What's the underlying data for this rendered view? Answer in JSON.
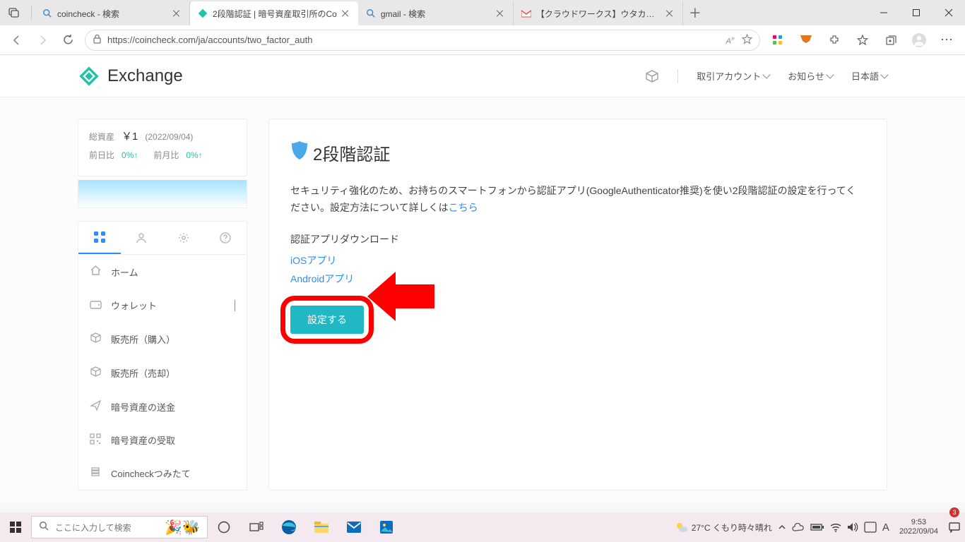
{
  "browser": {
    "tabs": [
      {
        "title": "coincheck - 検索",
        "favicon": "search"
      },
      {
        "title": "2段階認証 | 暗号資産取引所のCo",
        "favicon": "coincheck",
        "active": true
      },
      {
        "title": "gmail - 検索",
        "favicon": "search"
      },
      {
        "title": "【クラウドワークス】ウタカタブログさんか",
        "favicon": "gmail"
      }
    ],
    "url": "https://coincheck.com/ja/accounts/two_factor_auth"
  },
  "header": {
    "brand": "Exchange",
    "nav": {
      "account": "取引アカウント",
      "notice": "お知らせ",
      "lang": "日本語"
    }
  },
  "sidecard": {
    "total_label": "総資産",
    "total_amount": "￥1",
    "total_date": "(2022/09/04)",
    "day_label": "前日比",
    "day_pct": "0%↑",
    "month_label": "前月比",
    "month_pct": "0%↑"
  },
  "menu": {
    "home": "ホーム",
    "wallet": "ウォレット",
    "buy": "販売所（購入）",
    "sell": "販売所（売却）",
    "send": "暗号資産の送金",
    "receive": "暗号資産の受取",
    "tsumitate": "Coincheckつみたて"
  },
  "content": {
    "title": "2段階認証",
    "desc1": "セキュリティ強化のため、お持ちのスマートフォンから認証アプリ(GoogleAuthenticator推奨)を使い2段階認証の設定を行ってください。設定方法について詳しくは",
    "desc_link": "こちら",
    "dl_label": "認証アプリダウンロード",
    "ios": "iOSアプリ",
    "android": "Androidアプリ",
    "button": "設定する"
  },
  "taskbar": {
    "search_placeholder": "ここに入力して検索",
    "weather": "27°C くもり時々晴れ",
    "time": "9:53",
    "date": "2022/09/04",
    "ime": "A",
    "notif_count": "3"
  }
}
